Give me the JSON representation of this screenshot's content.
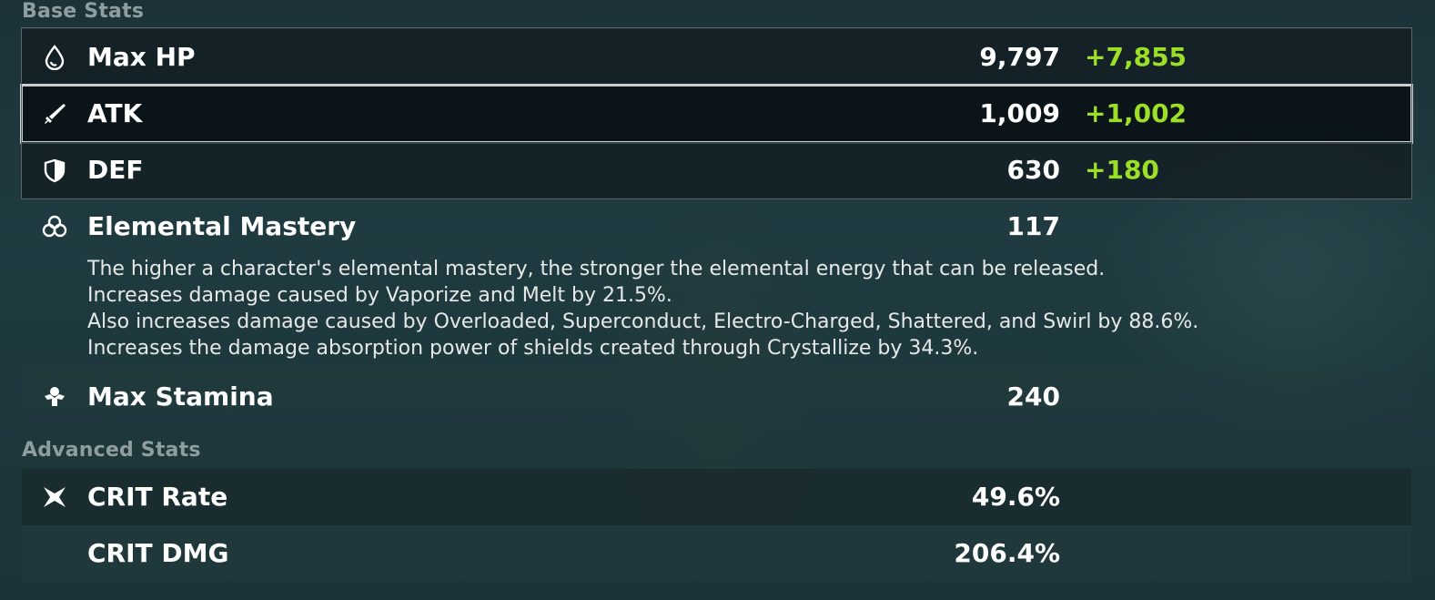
{
  "sections": {
    "base_title": "Base Stats",
    "advanced_title": "Advanced Stats"
  },
  "base_stats": [
    {
      "label": "Max HP",
      "value": "9,797",
      "bonus": "+7,855",
      "icon": "hp-drop-icon"
    },
    {
      "label": "ATK",
      "value": "1,009",
      "bonus": "+1,002",
      "icon": "sword-icon"
    },
    {
      "label": "DEF",
      "value": "630",
      "bonus": "+180",
      "icon": "shield-icon"
    },
    {
      "label": "Elemental Mastery",
      "value": "117",
      "icon": "elemental-mastery-icon"
    },
    {
      "label": "Max Stamina",
      "value": "240",
      "icon": "stamina-icon"
    }
  ],
  "elemental_mastery_description": [
    "The higher a character's elemental mastery, the stronger the elemental energy that can be released.",
    "Increases damage caused by Vaporize and Melt by 21.5%.",
    "Also increases damage caused by Overloaded, Superconduct, Electro-Charged, Shattered, and Swirl by 88.6%.",
    "Increases the damage absorption power of shields created through Crystallize by 34.3%."
  ],
  "advanced_stats": [
    {
      "label": "CRIT Rate",
      "value": "49.6%",
      "icon": "crit-star-icon"
    },
    {
      "label": "CRIT DMG",
      "value": "206.4%"
    }
  ],
  "colors": {
    "bonus_green": "#9bdf28",
    "section_grey": "#8e9da0",
    "selected_border": "#c9cdcd"
  }
}
